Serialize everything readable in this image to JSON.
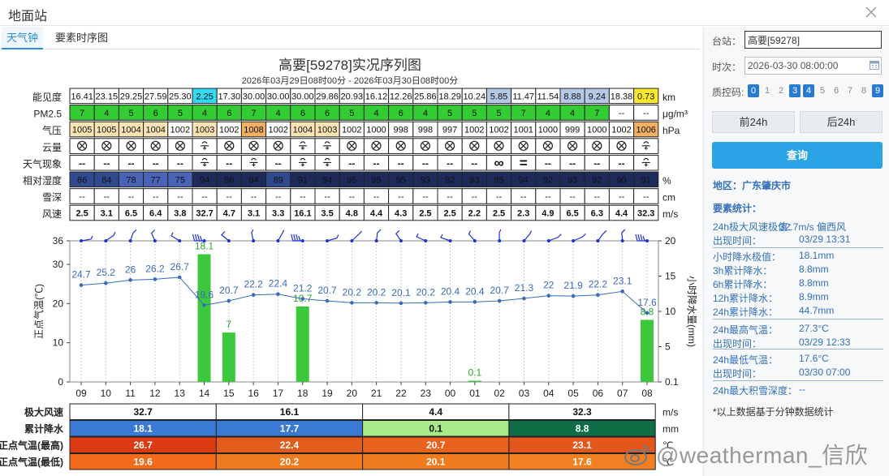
{
  "window": {
    "title": "地面站"
  },
  "tabs": [
    {
      "label": "天气钟",
      "active": true
    },
    {
      "label": "要素时序图",
      "active": false
    }
  ],
  "chart": {
    "title": "高要[59278]实况序列图",
    "subtitle": "2026年03月29日08时00分 - 2026年03月30日08时00分"
  },
  "hours": [
    "09",
    "10",
    "11",
    "12",
    "13",
    "14",
    "15",
    "16",
    "17",
    "18",
    "19",
    "20",
    "21",
    "22",
    "23",
    "00",
    "01",
    "02",
    "03",
    "04",
    "05",
    "06",
    "07",
    "08"
  ],
  "table": {
    "visibility": {
      "label": "能见度",
      "unit": "km",
      "values": [
        "16.41",
        "23.15",
        "29.25",
        "27.59",
        "25.30",
        "2.25",
        "17.30",
        "30.00",
        "30.00",
        "30.00",
        "29.86",
        "20.93",
        "16.12",
        "12.26",
        "25.86",
        "18.29",
        "10.24",
        "5.85",
        "11.47",
        "11.54",
        "8.88",
        "9.24",
        "18.38",
        "0.73"
      ]
    },
    "pm25": {
      "label": "PM2.5",
      "unit": "μg/m³",
      "values": [
        "7",
        "4",
        "5",
        "6",
        "5",
        "4",
        "6",
        "7",
        "4",
        "6",
        "6",
        "5",
        "4",
        "6",
        "4",
        "5",
        "5",
        "5",
        "7",
        "4",
        "4",
        "7",
        "--",
        "--"
      ]
    },
    "pressure": {
      "label": "气压",
      "unit": "hPa",
      "values": [
        "1005",
        "1005",
        "1004",
        "1004",
        "1002",
        "1003",
        "1002",
        "1008",
        "1002",
        "1004",
        "1003",
        "1002",
        "1000",
        "998",
        "998",
        "997",
        "1002",
        "1002",
        "1001",
        "1000",
        "999",
        "1000",
        "1002",
        "1006"
      ]
    },
    "cloud": {
      "label": "云量",
      "unit": ""
    },
    "weather": {
      "label": "天气现象",
      "unit": ""
    },
    "humidity": {
      "label": "相对湿度",
      "unit": "%",
      "values": [
        "86",
        "84",
        "78",
        "77",
        "75",
        "94",
        "96",
        "94",
        "89",
        "91",
        "94",
        "95",
        "95",
        "95",
        "93",
        "92",
        "93",
        "95",
        "94",
        "92",
        "93",
        "92",
        "90",
        "91"
      ]
    },
    "snow": {
      "label": "雪深",
      "unit": "cm",
      "values": [
        "--",
        "--",
        "--",
        "--",
        "--",
        "--",
        "--",
        "--",
        "--",
        "--",
        "--",
        "--",
        "--",
        "--",
        "--",
        "--",
        "--",
        "--",
        "--",
        "--",
        "--",
        "--",
        "--",
        "--"
      ]
    },
    "wind": {
      "label": "风速",
      "unit": "m/s",
      "values": [
        "2.5",
        "3.1",
        "6.5",
        "6.4",
        "3.8",
        "32.7",
        "4.7",
        "3.1",
        "3.3",
        "16.1",
        "3.5",
        "4.8",
        "4.4",
        "4.3",
        "2.5",
        "2.5",
        "2.2",
        "2.5",
        "2.3",
        "4.9",
        "6.5",
        "6.3",
        "4.4",
        "32.3"
      ]
    }
  },
  "chart_data": {
    "type": "line",
    "x": [
      "09",
      "10",
      "11",
      "12",
      "13",
      "14",
      "15",
      "16",
      "17",
      "18",
      "19",
      "20",
      "21",
      "22",
      "23",
      "00",
      "01",
      "02",
      "03",
      "04",
      "05",
      "06",
      "07",
      "08"
    ],
    "series": [
      {
        "values": [
          24.7,
          25.2,
          26,
          26.2,
          26.7,
          19.6,
          20.7,
          22.2,
          22.4,
          21.2,
          20.7,
          20.2,
          20.2,
          20.1,
          20.2,
          20.4,
          20.4,
          20.7,
          21.3,
          22,
          21.9,
          22.2,
          23.1,
          17.6
        ]
      },
      {
        "type": "bar",
        "values": [
          0,
          0,
          0,
          0,
          0,
          18.1,
          7,
          0,
          0,
          10.7,
          0,
          0,
          0,
          0,
          0,
          0,
          0.1,
          0,
          0,
          0,
          0,
          0,
          0,
          8.8
        ]
      }
    ],
    "temp_labels": [
      "24.7",
      "25.2",
      "26",
      "26.2",
      "26.7",
      "19.6",
      "20.7",
      "22.2",
      "22.4",
      "21.2",
      "20.7",
      "20.2",
      "20.2",
      "20.1",
      "20.2",
      "20.4",
      "20.4",
      "20.7",
      "21.3",
      "22",
      "21.9",
      "22.2",
      "23.1",
      "17.6"
    ],
    "rain_labels": [
      "18.1",
      "7",
      "10.7",
      "0.1",
      "8.8"
    ],
    "ylabel": "正点气温(℃)",
    "y2label": "小时降水量(mm)",
    "ylim": [
      0,
      36
    ],
    "y2lim": [
      0.1,
      20
    ],
    "yticks": [
      "0",
      "10",
      "20",
      "30",
      "36"
    ],
    "y2ticks": [
      "0.1",
      "5",
      "10",
      "15",
      "20"
    ],
    "grid": true,
    "colors": {
      "temp": "#3a6bb7",
      "rain": "#3cc83c",
      "rain_label": "#2ca02c",
      "wind": "#2030d0"
    }
  },
  "summary": {
    "rows": [
      {
        "label": "极大风速",
        "unit": "m/s",
        "values": [
          "32.7",
          "16.1",
          "4.4",
          "32.3"
        ]
      },
      {
        "label": "累计降水",
        "unit": "mm",
        "values": [
          "18.1",
          "17.7",
          "0.1",
          "8.8"
        ]
      },
      {
        "label": "正点气温(最高)",
        "unit": "℃",
        "values": [
          "26.7",
          "22.4",
          "20.7",
          "23.1"
        ]
      },
      {
        "label": "正点气温(最低)",
        "unit": "℃",
        "values": [
          "19.6",
          "20.2",
          "20.1",
          "17.6"
        ]
      }
    ]
  },
  "panel": {
    "station_label": "台站：",
    "station_value": "高要[59278]",
    "time_label": "时次：",
    "time_value": "2026-03-30 08:00:00",
    "qc_label": "质控码:",
    "qc_codes": [
      {
        "code": "0",
        "on": true
      },
      {
        "code": "1",
        "on": false
      },
      {
        "code": "2",
        "on": false
      },
      {
        "code": "3",
        "on": true
      },
      {
        "code": "4",
        "on": true
      },
      {
        "code": "5",
        "on": false
      },
      {
        "code": "6",
        "on": false
      },
      {
        "code": "7",
        "on": false
      },
      {
        "code": "8",
        "on": false
      },
      {
        "code": "9",
        "on": true
      }
    ],
    "prev_btn": "前24h",
    "next_btn": "后24h",
    "query_btn": "查询",
    "region": "地区：广东肇庆市",
    "stats_title": "要素统计：",
    "stats": [
      {
        "label": "24h极大风速极值：",
        "value": "32.7m/s 偏西风"
      },
      {
        "label": "出现时间：",
        "value": "03/29 13:31"
      },
      {
        "label": "小时降水极值：",
        "value": "18.1mm"
      },
      {
        "label": "3h累计降水：",
        "value": "8.8mm"
      },
      {
        "label": "6h累计降水：",
        "value": "8.8mm"
      },
      {
        "label": "12h累计降水：",
        "value": "8.9mm"
      },
      {
        "label": "24h累计降水：",
        "value": "44.7mm"
      },
      {
        "label": "24h最高气温：",
        "value": "27.3°C"
      },
      {
        "label": "出现时间：",
        "value": "03/29 12:33"
      },
      {
        "label": "24h最低气温：",
        "value": "17.6°C"
      },
      {
        "label": "出现时间：",
        "value": "03/30 07:00"
      },
      {
        "label": "24h最大积雪深度：",
        "value": "--"
      }
    ],
    "note": "*以上数据基于分钟数据统计"
  },
  "watermark": "@weatherman_信欣"
}
